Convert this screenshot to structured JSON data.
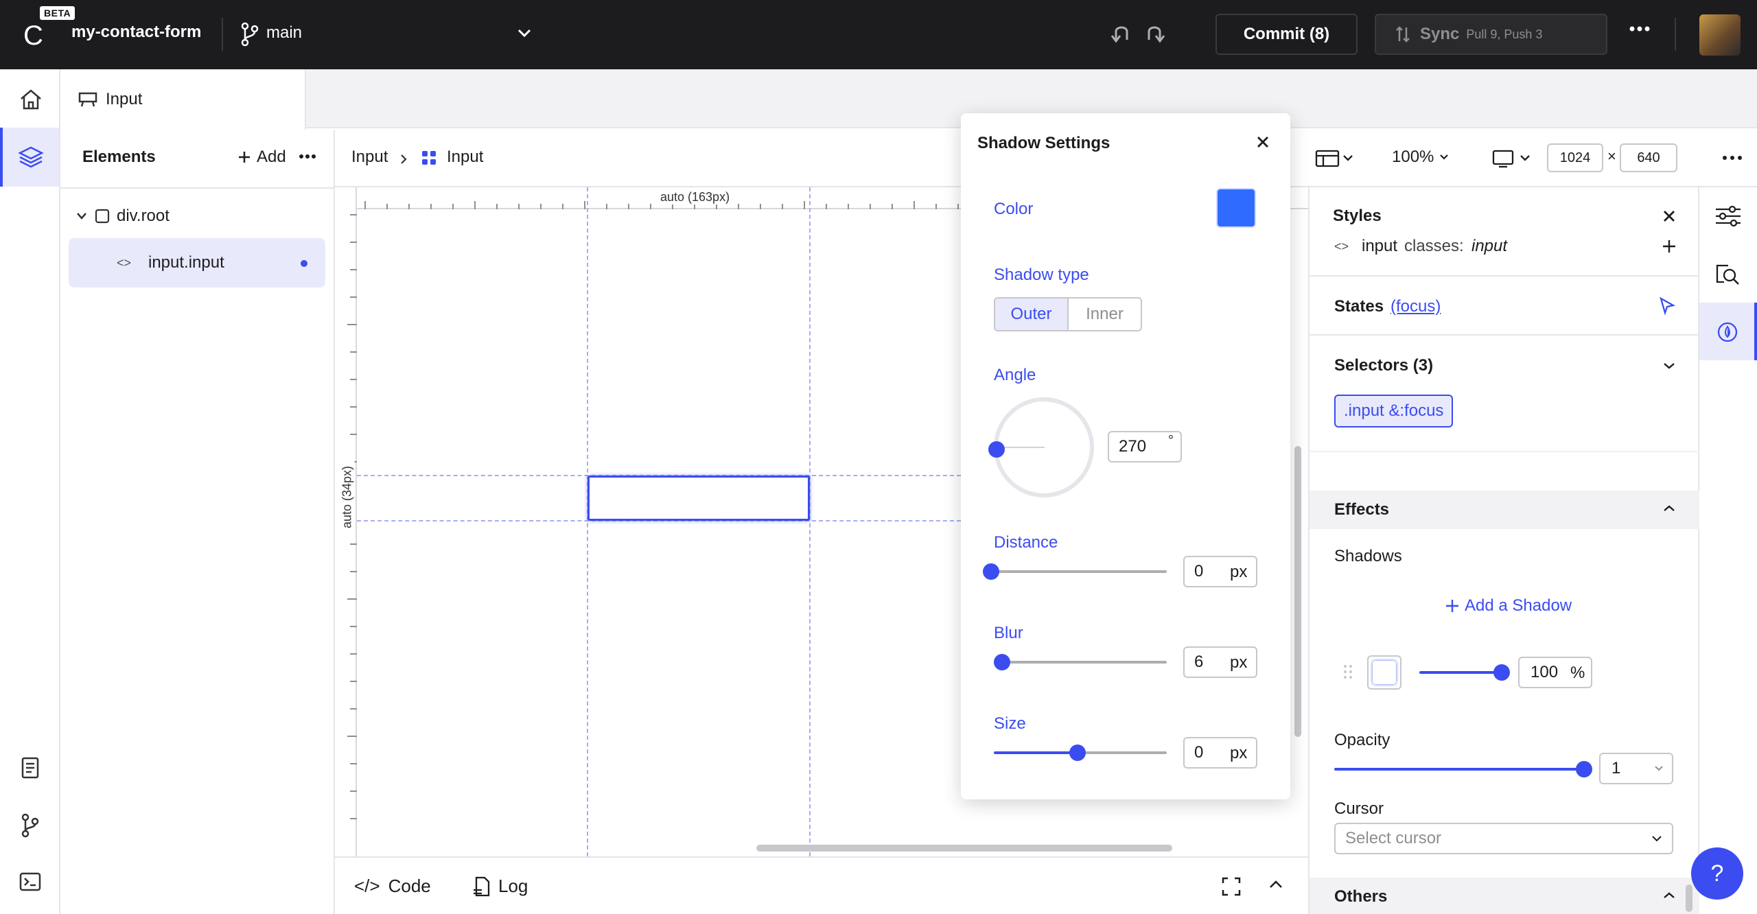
{
  "topbar": {
    "logo": "C",
    "beta": "BETA",
    "project": "my-contact-form",
    "branch": "main",
    "commit_label": "Commit (8)",
    "sync_label": "Sync",
    "sync_sub": "Pull 9, Push 3"
  },
  "tab": {
    "label": "Input"
  },
  "elements": {
    "title": "Elements",
    "add_label": "Add",
    "tree": [
      {
        "label": "div.root"
      },
      {
        "label": "input.input",
        "code": "<>"
      }
    ]
  },
  "canvas": {
    "breadcrumb": [
      "Input",
      "Input"
    ],
    "ruler_top_label": "auto (163px)",
    "ruler_left_label": "auto (34px)"
  },
  "bottombar": {
    "code_label": "Code",
    "code_glyph": "</>",
    "log_label": "Log"
  },
  "shadow_popup": {
    "title": "Shadow Settings",
    "color_label": "Color",
    "color_value": "#2f6bff",
    "type_label": "Shadow type",
    "type_options": [
      "Outer",
      "Inner"
    ],
    "type_selected": "Outer",
    "angle_label": "Angle",
    "angle_value": "270",
    "angle_unit": "°",
    "distance_label": "Distance",
    "distance_value": "0",
    "blur_label": "Blur",
    "blur_value": "6",
    "size_label": "Size",
    "size_value": "0",
    "unit": "px"
  },
  "toolbar": {
    "zoom": "100%",
    "width": "1024",
    "times": "×",
    "height": "640"
  },
  "styles": {
    "title": "Styles",
    "element_code": "<>",
    "element": "input",
    "classes_label": "classes:",
    "classes_value": "input",
    "states_label": "States",
    "states_value": "(focus)",
    "selectors_label": "Selectors (3)",
    "selector_chip": ".input &:focus",
    "effects_label": "Effects",
    "shadows_label": "Shadows",
    "add_shadow": "Add a Shadow",
    "shadow_opacity": "100",
    "shadow_opacity_unit": "%",
    "opacity_label": "Opacity",
    "opacity_value": "1",
    "cursor_label": "Cursor",
    "cursor_placeholder": "Select cursor",
    "others_label": "Others"
  },
  "help": "?"
}
